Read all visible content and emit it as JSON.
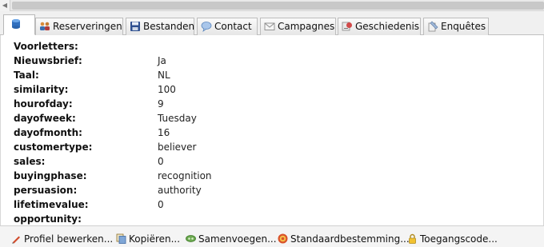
{
  "tabs": [
    {
      "label": "",
      "icon": "database-icon",
      "active": true
    },
    {
      "label": "Reserveringen",
      "icon": "people-icon"
    },
    {
      "label": "Bestanden",
      "icon": "save-disk-icon"
    },
    {
      "label": "Contact",
      "icon": "speech-bubble-icon"
    },
    {
      "label": "Campagnes",
      "icon": "envelope-icon"
    },
    {
      "label": "Geschiedenis",
      "icon": "history-icon"
    },
    {
      "label": "Enquêtes",
      "icon": "survey-icon"
    }
  ],
  "fields": [
    {
      "label": "Voorletters:",
      "value": ""
    },
    {
      "label": "Nieuwsbrief:",
      "value": "Ja"
    },
    {
      "label": "Taal:",
      "value": "NL"
    },
    {
      "label": "similarity:",
      "value": "100"
    },
    {
      "label": "hourofday:",
      "value": "9"
    },
    {
      "label": "dayofweek:",
      "value": "Tuesday"
    },
    {
      "label": "dayofmonth:",
      "value": "16"
    },
    {
      "label": "customertype:",
      "value": "believer"
    },
    {
      "label": "sales:",
      "value": "0"
    },
    {
      "label": "buyingphase:",
      "value": "recognition"
    },
    {
      "label": "persuasion:",
      "value": "authority"
    },
    {
      "label": "lifetimevalue:",
      "value": "0"
    },
    {
      "label": "opportunity:",
      "value": ""
    }
  ],
  "actions": [
    {
      "label": "Profiel bewerken...",
      "icon": "pencil-icon"
    },
    {
      "label": "Kopiëren...",
      "icon": "copy-icon"
    },
    {
      "label": "Samenvoegen...",
      "icon": "merge-icon"
    },
    {
      "label": "Standaardbestemming...",
      "icon": "target-icon"
    },
    {
      "label": "Toegangscode...",
      "icon": "lock-icon"
    }
  ]
}
